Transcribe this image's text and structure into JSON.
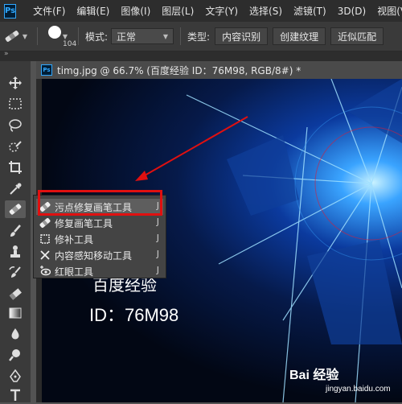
{
  "menubar": {
    "logo": "Ps",
    "items": [
      "文件(F)",
      "编辑(E)",
      "图像(I)",
      "图层(L)",
      "文字(Y)",
      "选择(S)",
      "滤镜(T)",
      "3D(D)",
      "视图(V"
    ]
  },
  "options": {
    "brush_size": "104",
    "mode_label": "模式:",
    "mode_value": "正常",
    "type_label": "类型:",
    "type_buttons": [
      "内容识别",
      "创建纹理",
      "近似匹配"
    ]
  },
  "document": {
    "tab_icon": "Ps",
    "tab_title": "timg.jpg @ 66.7% (百度经验 ID：76M98, RGB/8#) *",
    "canvas_text_1": "百度经验",
    "canvas_text_2": "ID：76M98",
    "watermark": "Bai 经验",
    "watermark_url": "jingyan.baidu.com"
  },
  "flyout": {
    "items": [
      {
        "label": "污点修复画笔工具",
        "key": "J",
        "icon": "spot-healing-brush-icon"
      },
      {
        "label": "修复画笔工具",
        "key": "J",
        "icon": "healing-brush-icon"
      },
      {
        "label": "修补工具",
        "key": "J",
        "icon": "patch-icon"
      },
      {
        "label": "内容感知移动工具",
        "key": "J",
        "icon": "content-aware-move-icon"
      },
      {
        "label": "红眼工具",
        "key": "J",
        "icon": "red-eye-icon"
      }
    ]
  },
  "colors": {
    "highlight_box": "#e01010",
    "arrow": "#e01010",
    "ps_blue": "#31a8ff"
  }
}
